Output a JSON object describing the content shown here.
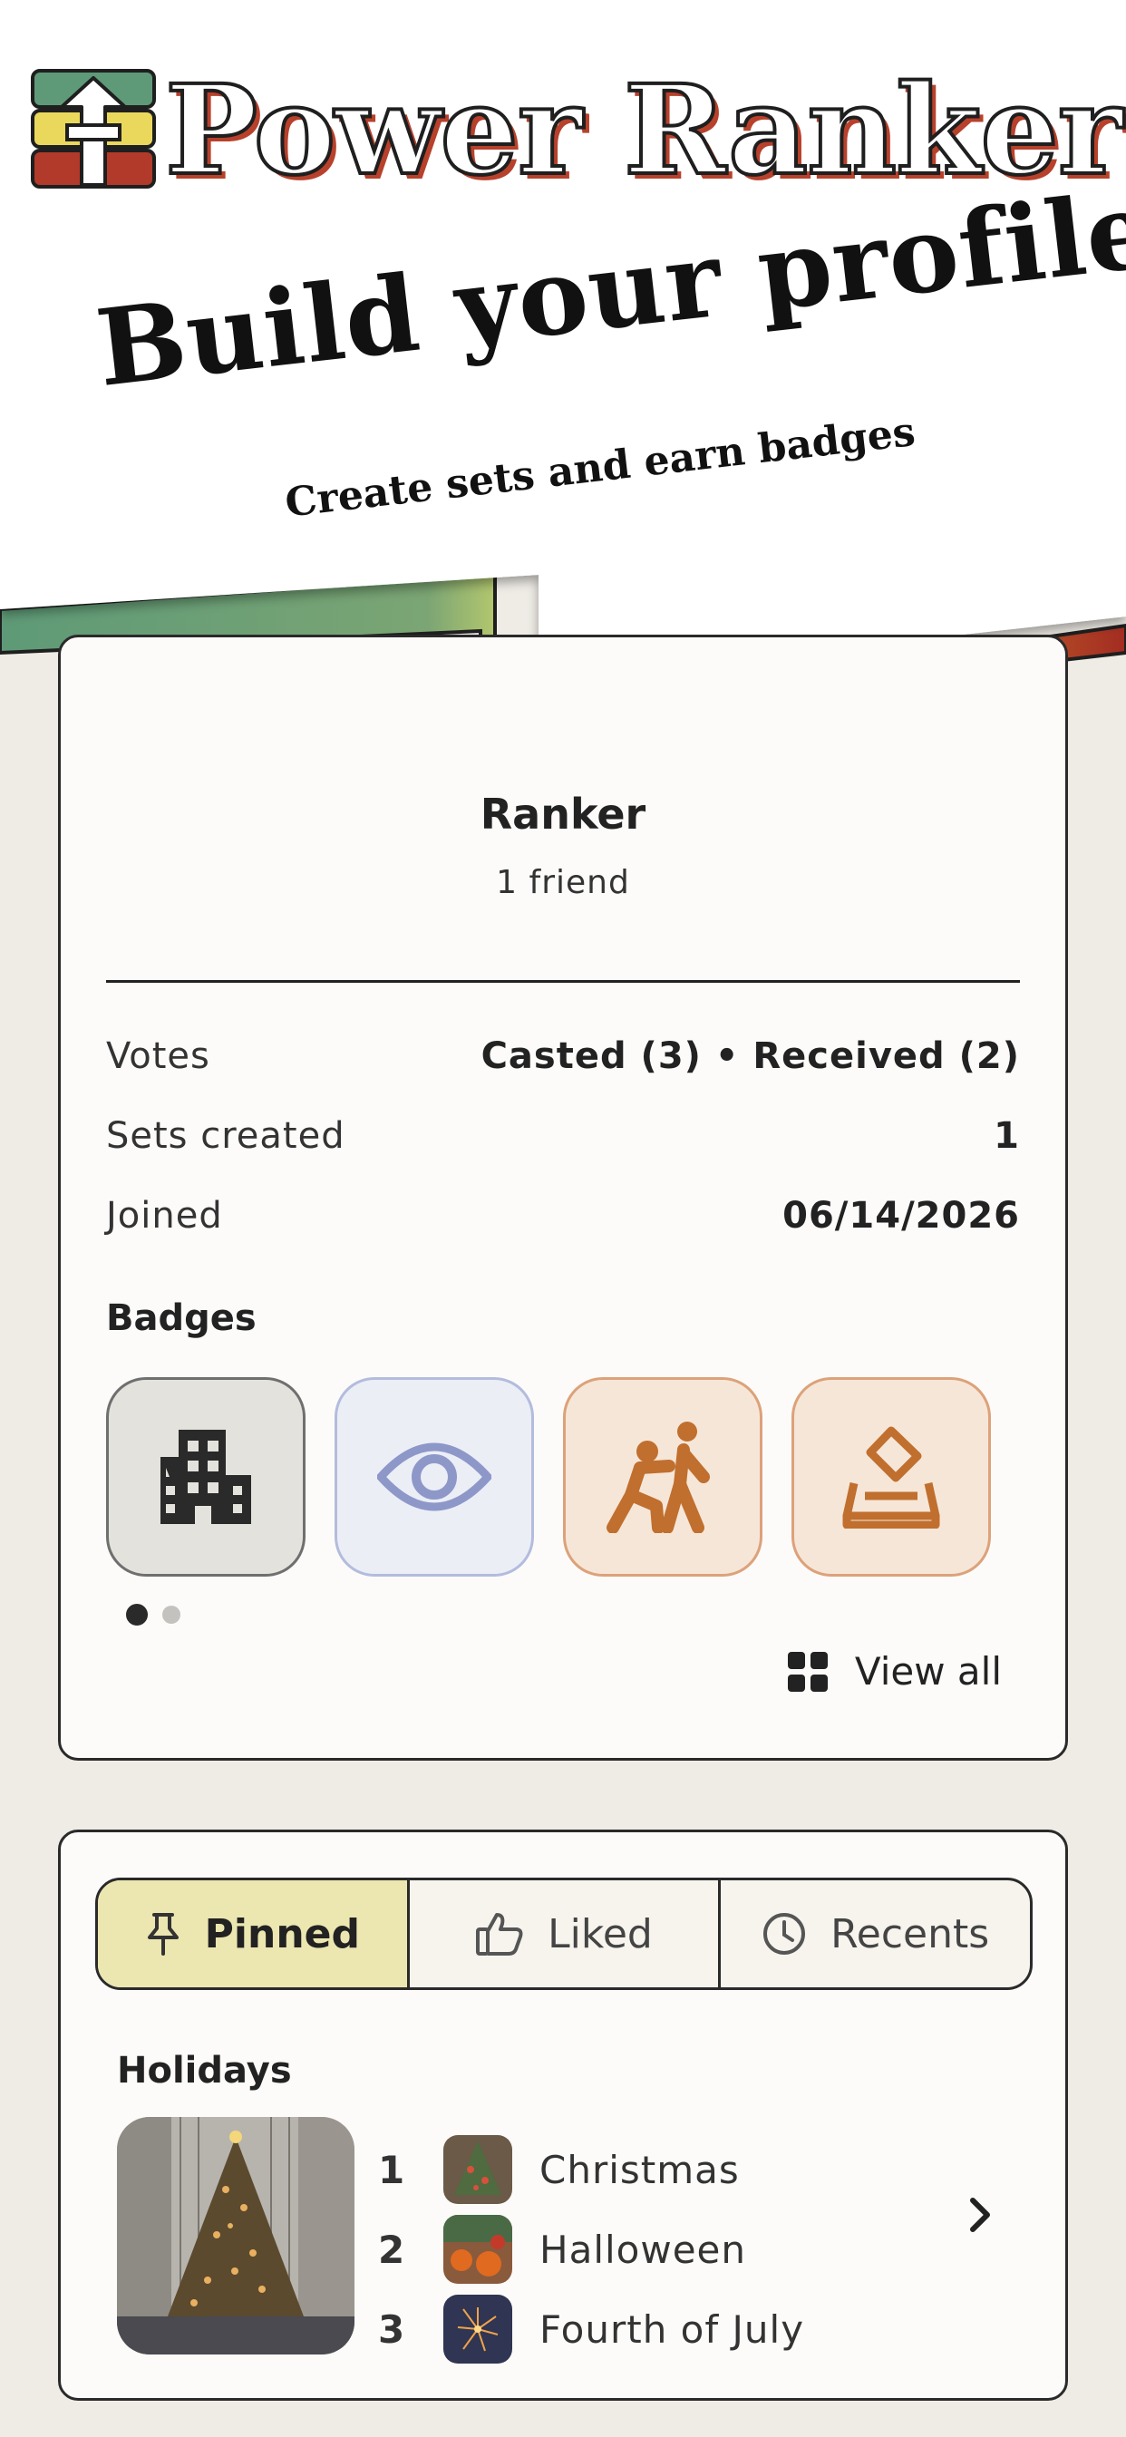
{
  "app": {
    "logo_text": "Power Ranker",
    "brand_colors": {
      "green": "#5e9a77",
      "yellow": "#e4d35a",
      "red": "#b23a2a",
      "lime": "#cfd86a"
    }
  },
  "hero": {
    "headline": "Build your profile",
    "subheadline": "Create sets and earn badges"
  },
  "profile": {
    "name": "Ranker",
    "friends": "1 friend",
    "stats": {
      "votes_label": "Votes",
      "votes_value": "Casted (3) • Received (2)",
      "sets_label": "Sets created",
      "sets_value": "1",
      "joined_label": "Joined",
      "joined_value": "06/14/2026"
    },
    "badges_title": "Badges",
    "badges": [
      {
        "icon": "building-icon"
      },
      {
        "icon": "eye-icon"
      },
      {
        "icon": "people-pushing-icon"
      },
      {
        "icon": "ballot-box-icon"
      }
    ],
    "view_all_label": "View all"
  },
  "tabs": [
    {
      "label": "Pinned",
      "icon": "pin-icon",
      "active": true
    },
    {
      "label": "Liked",
      "icon": "thumbs-up-icon",
      "active": false
    },
    {
      "label": "Recents",
      "icon": "clock-icon",
      "active": false
    }
  ],
  "pinned_set": {
    "title": "Holidays",
    "items": [
      {
        "rank": "1",
        "name": "Christmas"
      },
      {
        "rank": "2",
        "name": "Halloween"
      },
      {
        "rank": "3",
        "name": "Fourth of July"
      }
    ]
  }
}
